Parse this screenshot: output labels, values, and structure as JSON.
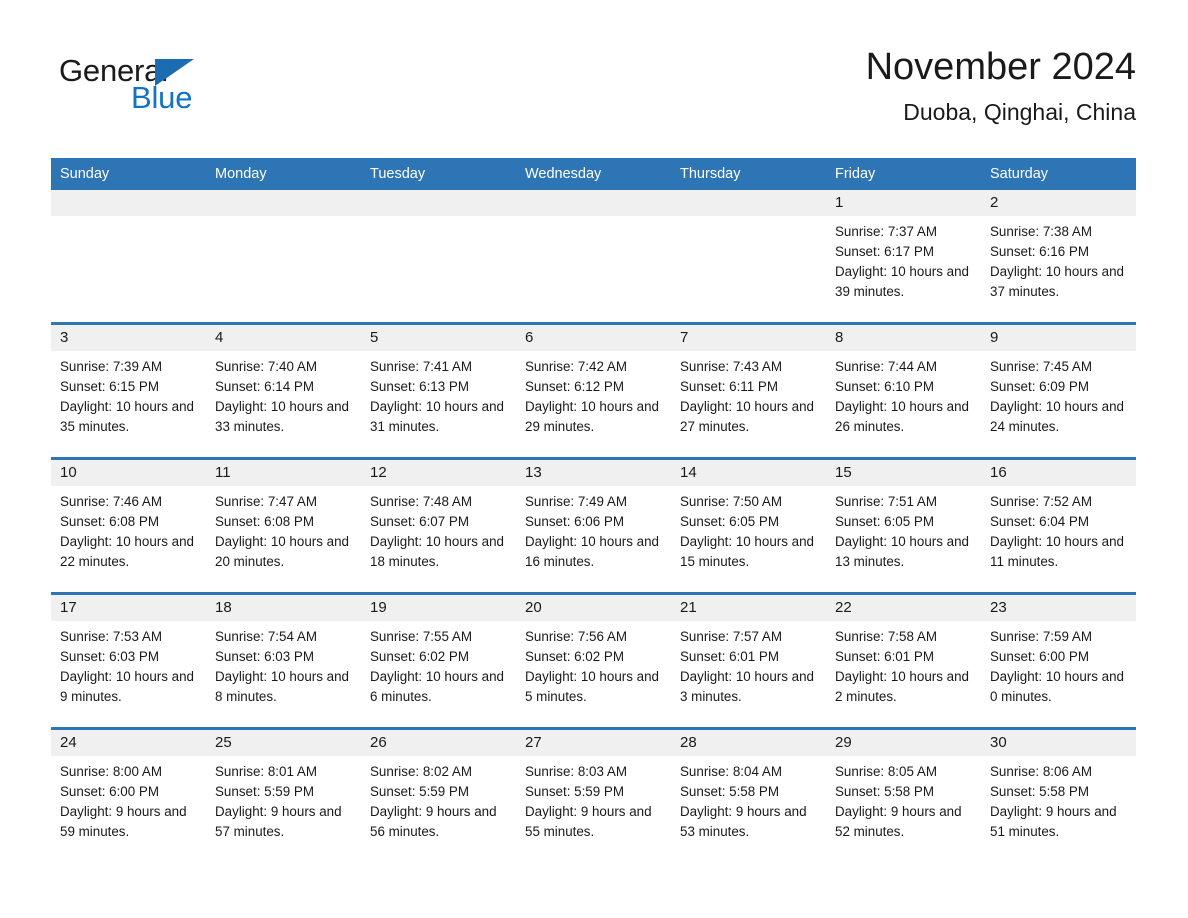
{
  "brand": {
    "name_part1": "General",
    "name_part2": "Blue",
    "accent_color": "#1274c4",
    "triangle_color": "#1b6cb0"
  },
  "header": {
    "month_title": "November 2024",
    "location": "Duoba, Qinghai, China"
  },
  "theme": {
    "header_blue": "#2e75b6",
    "daynum_band": "#f0f0f0",
    "text": "#1a1a1a"
  },
  "weekday_headers": [
    "Sunday",
    "Monday",
    "Tuesday",
    "Wednesday",
    "Thursday",
    "Friday",
    "Saturday"
  ],
  "labels": {
    "sunrise_prefix": "Sunrise:",
    "sunset_prefix": "Sunset:",
    "daylight_prefix": "Daylight:"
  },
  "weeks": [
    [
      {
        "day": "",
        "sunrise": "",
        "sunset": "",
        "daylight": ""
      },
      {
        "day": "",
        "sunrise": "",
        "sunset": "",
        "daylight": ""
      },
      {
        "day": "",
        "sunrise": "",
        "sunset": "",
        "daylight": ""
      },
      {
        "day": "",
        "sunrise": "",
        "sunset": "",
        "daylight": ""
      },
      {
        "day": "",
        "sunrise": "",
        "sunset": "",
        "daylight": ""
      },
      {
        "day": "1",
        "sunrise": "Sunrise: 7:37 AM",
        "sunset": "Sunset: 6:17 PM",
        "daylight": "Daylight: 10 hours and 39 minutes."
      },
      {
        "day": "2",
        "sunrise": "Sunrise: 7:38 AM",
        "sunset": "Sunset: 6:16 PM",
        "daylight": "Daylight: 10 hours and 37 minutes."
      }
    ],
    [
      {
        "day": "3",
        "sunrise": "Sunrise: 7:39 AM",
        "sunset": "Sunset: 6:15 PM",
        "daylight": "Daylight: 10 hours and 35 minutes."
      },
      {
        "day": "4",
        "sunrise": "Sunrise: 7:40 AM",
        "sunset": "Sunset: 6:14 PM",
        "daylight": "Daylight: 10 hours and 33 minutes."
      },
      {
        "day": "5",
        "sunrise": "Sunrise: 7:41 AM",
        "sunset": "Sunset: 6:13 PM",
        "daylight": "Daylight: 10 hours and 31 minutes."
      },
      {
        "day": "6",
        "sunrise": "Sunrise: 7:42 AM",
        "sunset": "Sunset: 6:12 PM",
        "daylight": "Daylight: 10 hours and 29 minutes."
      },
      {
        "day": "7",
        "sunrise": "Sunrise: 7:43 AM",
        "sunset": "Sunset: 6:11 PM",
        "daylight": "Daylight: 10 hours and 27 minutes."
      },
      {
        "day": "8",
        "sunrise": "Sunrise: 7:44 AM",
        "sunset": "Sunset: 6:10 PM",
        "daylight": "Daylight: 10 hours and 26 minutes."
      },
      {
        "day": "9",
        "sunrise": "Sunrise: 7:45 AM",
        "sunset": "Sunset: 6:09 PM",
        "daylight": "Daylight: 10 hours and 24 minutes."
      }
    ],
    [
      {
        "day": "10",
        "sunrise": "Sunrise: 7:46 AM",
        "sunset": "Sunset: 6:08 PM",
        "daylight": "Daylight: 10 hours and 22 minutes."
      },
      {
        "day": "11",
        "sunrise": "Sunrise: 7:47 AM",
        "sunset": "Sunset: 6:08 PM",
        "daylight": "Daylight: 10 hours and 20 minutes."
      },
      {
        "day": "12",
        "sunrise": "Sunrise: 7:48 AM",
        "sunset": "Sunset: 6:07 PM",
        "daylight": "Daylight: 10 hours and 18 minutes."
      },
      {
        "day": "13",
        "sunrise": "Sunrise: 7:49 AM",
        "sunset": "Sunset: 6:06 PM",
        "daylight": "Daylight: 10 hours and 16 minutes."
      },
      {
        "day": "14",
        "sunrise": "Sunrise: 7:50 AM",
        "sunset": "Sunset: 6:05 PM",
        "daylight": "Daylight: 10 hours and 15 minutes."
      },
      {
        "day": "15",
        "sunrise": "Sunrise: 7:51 AM",
        "sunset": "Sunset: 6:05 PM",
        "daylight": "Daylight: 10 hours and 13 minutes."
      },
      {
        "day": "16",
        "sunrise": "Sunrise: 7:52 AM",
        "sunset": "Sunset: 6:04 PM",
        "daylight": "Daylight: 10 hours and 11 minutes."
      }
    ],
    [
      {
        "day": "17",
        "sunrise": "Sunrise: 7:53 AM",
        "sunset": "Sunset: 6:03 PM",
        "daylight": "Daylight: 10 hours and 9 minutes."
      },
      {
        "day": "18",
        "sunrise": "Sunrise: 7:54 AM",
        "sunset": "Sunset: 6:03 PM",
        "daylight": "Daylight: 10 hours and 8 minutes."
      },
      {
        "day": "19",
        "sunrise": "Sunrise: 7:55 AM",
        "sunset": "Sunset: 6:02 PM",
        "daylight": "Daylight: 10 hours and 6 minutes."
      },
      {
        "day": "20",
        "sunrise": "Sunrise: 7:56 AM",
        "sunset": "Sunset: 6:02 PM",
        "daylight": "Daylight: 10 hours and 5 minutes."
      },
      {
        "day": "21",
        "sunrise": "Sunrise: 7:57 AM",
        "sunset": "Sunset: 6:01 PM",
        "daylight": "Daylight: 10 hours and 3 minutes."
      },
      {
        "day": "22",
        "sunrise": "Sunrise: 7:58 AM",
        "sunset": "Sunset: 6:01 PM",
        "daylight": "Daylight: 10 hours and 2 minutes."
      },
      {
        "day": "23",
        "sunrise": "Sunrise: 7:59 AM",
        "sunset": "Sunset: 6:00 PM",
        "daylight": "Daylight: 10 hours and 0 minutes."
      }
    ],
    [
      {
        "day": "24",
        "sunrise": "Sunrise: 8:00 AM",
        "sunset": "Sunset: 6:00 PM",
        "daylight": "Daylight: 9 hours and 59 minutes."
      },
      {
        "day": "25",
        "sunrise": "Sunrise: 8:01 AM",
        "sunset": "Sunset: 5:59 PM",
        "daylight": "Daylight: 9 hours and 57 minutes."
      },
      {
        "day": "26",
        "sunrise": "Sunrise: 8:02 AM",
        "sunset": "Sunset: 5:59 PM",
        "daylight": "Daylight: 9 hours and 56 minutes."
      },
      {
        "day": "27",
        "sunrise": "Sunrise: 8:03 AM",
        "sunset": "Sunset: 5:59 PM",
        "daylight": "Daylight: 9 hours and 55 minutes."
      },
      {
        "day": "28",
        "sunrise": "Sunrise: 8:04 AM",
        "sunset": "Sunset: 5:58 PM",
        "daylight": "Daylight: 9 hours and 53 minutes."
      },
      {
        "day": "29",
        "sunrise": "Sunrise: 8:05 AM",
        "sunset": "Sunset: 5:58 PM",
        "daylight": "Daylight: 9 hours and 52 minutes."
      },
      {
        "day": "30",
        "sunrise": "Sunrise: 8:06 AM",
        "sunset": "Sunset: 5:58 PM",
        "daylight": "Daylight: 9 hours and 51 minutes."
      }
    ]
  ]
}
